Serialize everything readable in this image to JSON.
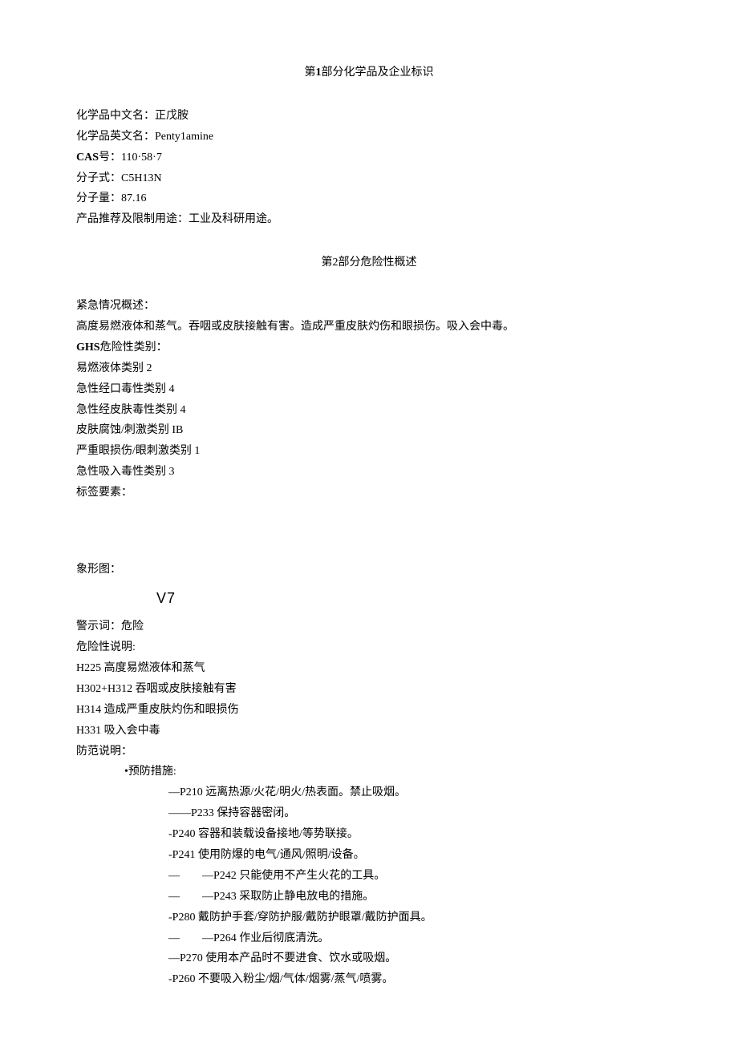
{
  "section1": {
    "title_prefix": "第",
    "title_num": "1",
    "title_suffix": "部分化学品及企业标识",
    "lines": {
      "cn_name_label": "化学品中文名：",
      "cn_name_value": "正戊胺",
      "en_name_label": "化学品英文名：",
      "en_name_value": "Penty1amine",
      "cas_label": "CAS",
      "cas_label2": "号：",
      "cas_value": "110·58·7",
      "formula_label": "分子式：",
      "formula_value": "C5H13N",
      "mw_label": "分子量：",
      "mw_value": "87.16",
      "use_label": "产品推荐及限制用途：",
      "use_value": "工业及科研用途。"
    }
  },
  "section2": {
    "title_prefix": "第",
    "title_num": "2",
    "title_suffix": "部分危险性概述",
    "emergency_label": "紧急情况概述：",
    "emergency_text": "高度易燃液体和蒸气。吞咽或皮肤接触有害。造成严重皮肤灼伤和眼损伤。吸入会中毒。",
    "ghs_label": "GHS",
    "ghs_label2": "危险性类别：",
    "ghs_categories": [
      "易燃液体类别 2",
      "急性经口毒性类别 4",
      "急性经皮肤毒性类别 4",
      "皮肤腐蚀/刺激类别 IB",
      "严重眼损伤/眼刺激类别 1",
      "急性吸入毒性类别 3"
    ],
    "label_elements": "标签要素：",
    "pictogram_label": "象形图：",
    "pictogram_placeholder": "V7",
    "signal_label": "警示词：",
    "signal_value": "危险",
    "hazard_label": "危险性说明:",
    "hazard_statements": [
      "H225 高度易燃液体和蒸气",
      "H302+H312 吞咽或皮肤接触有害",
      "H314 造成严重皮肤灼伤和眼损伤",
      "H331 吸入会中毒"
    ],
    "precaution_label": "防范说明：",
    "prevention_header": "•预防措施:",
    "prevention_items": [
      "—P210 远离热源/火花/明火/热表面。禁止吸烟。",
      "——P233 保持容器密闭。",
      "-P240 容器和装载设备接地/等势联接。",
      "-P241 使用防爆的电气/通风/照明/设备。",
      "—　　—P242 只能使用不产生火花的工具。",
      "—　　—P243 采取防止静电放电的措施。",
      "-P280 戴防护手套/穿防护服/戴防护眼罩/戴防护面具。",
      "—　　—P264 作业后彻底清洗。",
      "—P270 使用本产品时不要进食、饮水或吸烟。",
      "-P260 不要吸入粉尘/烟/气体/烟雾/蒸气/喷雾。"
    ]
  }
}
